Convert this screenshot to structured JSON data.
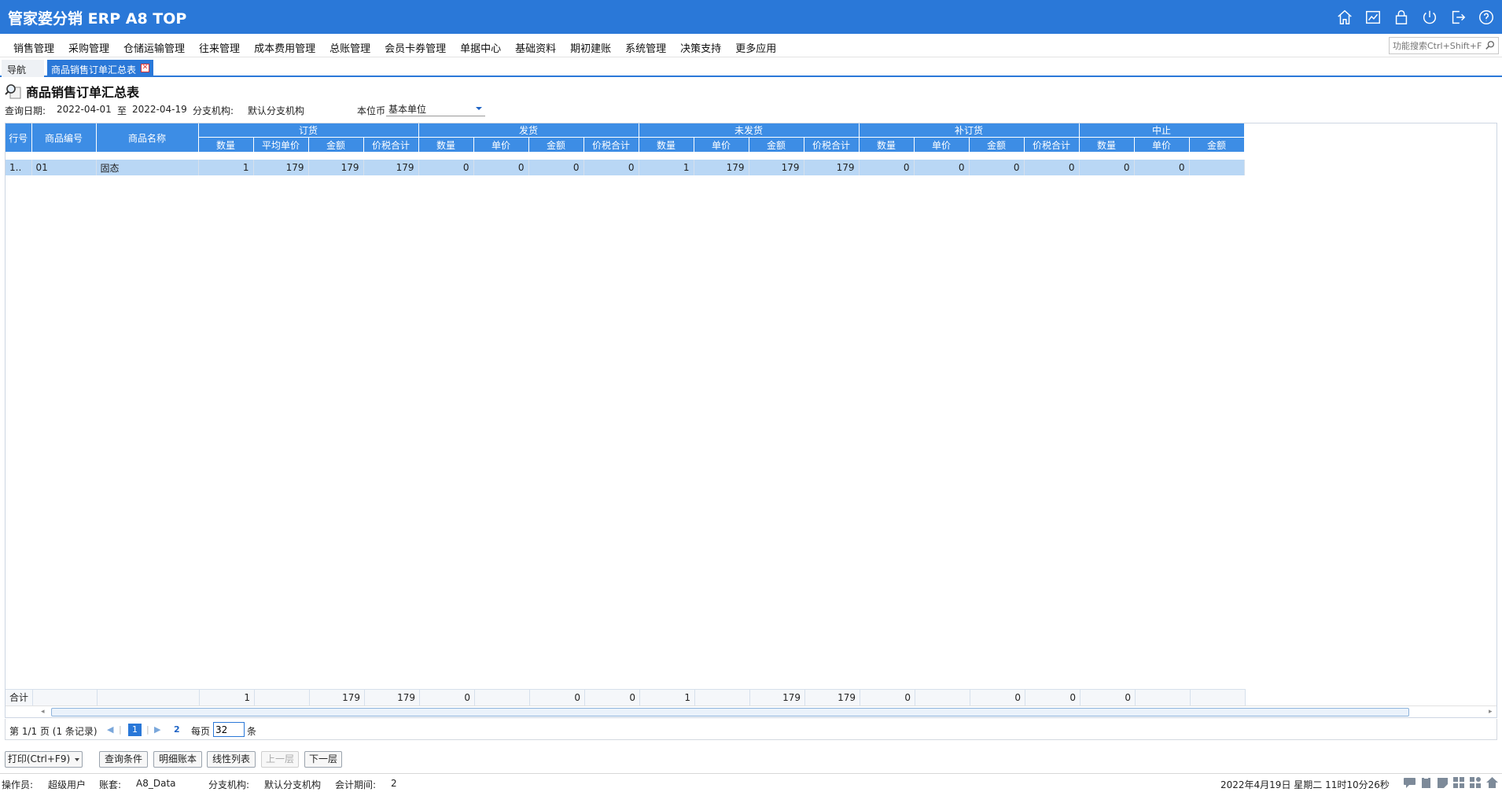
{
  "app": {
    "title": "管家婆分销 ERP A8 TOP"
  },
  "top_icons": [
    "home-icon",
    "chart-icon",
    "lock-icon",
    "power-icon",
    "exit-icon",
    "help-icon"
  ],
  "menu": [
    {
      "label": "销售管理"
    },
    {
      "label": "采购管理"
    },
    {
      "label": "仓储运输管理"
    },
    {
      "label": "往来管理"
    },
    {
      "label": "成本费用管理"
    },
    {
      "label": "总账管理"
    },
    {
      "label": "会员卡券管理"
    },
    {
      "label": "单据中心"
    },
    {
      "label": "基础资料"
    },
    {
      "label": "期初建账"
    },
    {
      "label": "系统管理"
    },
    {
      "label": "决策支持"
    },
    {
      "label": "更多应用"
    }
  ],
  "search": {
    "placeholder": "功能搜索Ctrl+Shift+F"
  },
  "tabs": {
    "nav": "导航",
    "active": "商品销售订单汇总表"
  },
  "report": {
    "title": "商品销售订单汇总表",
    "query_date_label": "查询日期:",
    "date_from": "2022-04-01",
    "to_label": "至",
    "date_to": "2022-04-19",
    "branch_label": "分支机构:",
    "branch_value": "默认分支机构",
    "currency_label": "本位币",
    "currency_value": "基本单位"
  },
  "grid": {
    "fixed_headers": [
      "行号",
      "商品编号",
      "商品名称"
    ],
    "groups": [
      {
        "label": "订货",
        "cols": [
          "数量",
          "平均单价",
          "金额",
          "价税合计"
        ]
      },
      {
        "label": "发货",
        "cols": [
          "数量",
          "单价",
          "金额",
          "价税合计"
        ]
      },
      {
        "label": "未发货",
        "cols": [
          "数量",
          "单价",
          "金额",
          "价税合计"
        ]
      },
      {
        "label": "补订货",
        "cols": [
          "数量",
          "单价",
          "金额",
          "价税合计"
        ]
      },
      {
        "label": "中止",
        "cols": [
          "数量",
          "单价",
          "金额"
        ]
      }
    ],
    "rows": [
      {
        "row_no": "1..",
        "code": "01",
        "name": "固态",
        "values": [
          "1",
          "179",
          "179",
          "179",
          "0",
          "0",
          "0",
          "0",
          "1",
          "179",
          "179",
          "179",
          "0",
          "0",
          "0",
          "0",
          "0",
          "0",
          ""
        ]
      }
    ],
    "totals": {
      "label": "合计",
      "values": [
        "1",
        "",
        "179",
        "179",
        "0",
        "",
        "0",
        "0",
        "1",
        "",
        "179",
        "179",
        "0",
        "",
        "0",
        "0",
        "0",
        "",
        ""
      ]
    }
  },
  "pager": {
    "page_info": "第  1/1 页  (1 条记录)",
    "current_page": "1",
    "refresh": "2",
    "per_page_label": "每页",
    "per_page_value": "32",
    "unit_label": "条"
  },
  "buttons": {
    "print": "打印(Ctrl+F9)",
    "query": "查询条件",
    "detail": "明细账本",
    "line_list": "线性列表",
    "up": "上一层",
    "down": "下一层"
  },
  "status": {
    "operator_label": "操作员:",
    "operator": "超级用户",
    "account_label": "账套:",
    "account": "A8_Data",
    "branch_label": "分支机构:",
    "branch": "默认分支机构",
    "period_label": "会计期间:",
    "period": "2",
    "datetime": "2022年4月19日  星期二  11时10分26秒"
  },
  "status_icons": [
    "message-icon",
    "clipboard-icon",
    "note-icon",
    "grid-icon",
    "apps-icon",
    "home-small-icon"
  ]
}
